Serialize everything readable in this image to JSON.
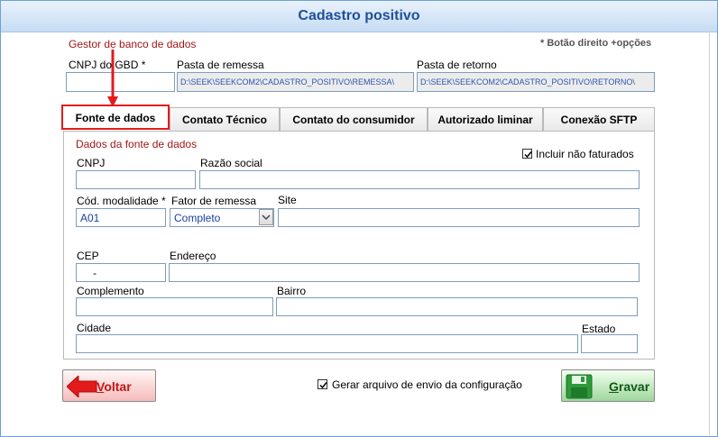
{
  "window": {
    "title": "Cadastro positivo"
  },
  "header": {
    "gestor_label": "Gestor de banco de dados",
    "hint": "* Botão direito +opções",
    "cnpj_gbd_label": "CNPJ do GBD *",
    "cnpj_gbd_value": "",
    "pasta_remessa_label": "Pasta de remessa",
    "pasta_remessa_value": "D:\\SEEK\\SEEKCOM2\\CADASTRO_POSITIVO\\REMESSA\\",
    "pasta_retorno_label": "Pasta de retorno",
    "pasta_retorno_value": "D:\\SEEK\\SEEKCOM2\\CADASTRO_POSITIVO\\RETORNO\\"
  },
  "tabs": [
    {
      "label": "Fonte de dados",
      "active": true
    },
    {
      "label": "Contato Técnico"
    },
    {
      "label": "Contato do consumidor"
    },
    {
      "label": "Autorizado liminar"
    },
    {
      "label": "Conexão SFTP"
    }
  ],
  "panel": {
    "section_title": "Dados da fonte de dados",
    "incluir_label": "Incluir não faturados",
    "incluir_checked": true,
    "cnpj_label": "CNPJ",
    "cnpj_value": "",
    "razao_label": "Razão social",
    "razao_value": "",
    "modalidade_label": "Cód. modalidade *",
    "modalidade_value": "A01",
    "fator_label": "Fator de remessa",
    "fator_value": "Completo",
    "site_label": "Site",
    "site_value": "",
    "cep_label": "CEP",
    "cep_value": "-",
    "endereco_label": "Endereço",
    "endereco_value": "",
    "complemento_label": "Complemento",
    "complemento_value": "",
    "bairro_label": "Bairro",
    "bairro_value": "",
    "cidade_label": "Cidade",
    "cidade_value": "",
    "estado_label": "Estado",
    "estado_value": ""
  },
  "footer": {
    "voltar_label_rest": "oltar",
    "voltar_label_first": "V",
    "gerar_label": "Gerar arquivo de envio da configuração",
    "gerar_checked": true,
    "gravar_label_first": "G",
    "gravar_label_rest": "ravar"
  },
  "colors": {
    "accent_red": "#e31b1b",
    "title_blue": "#1f4f9a",
    "label_red": "#a01818"
  }
}
